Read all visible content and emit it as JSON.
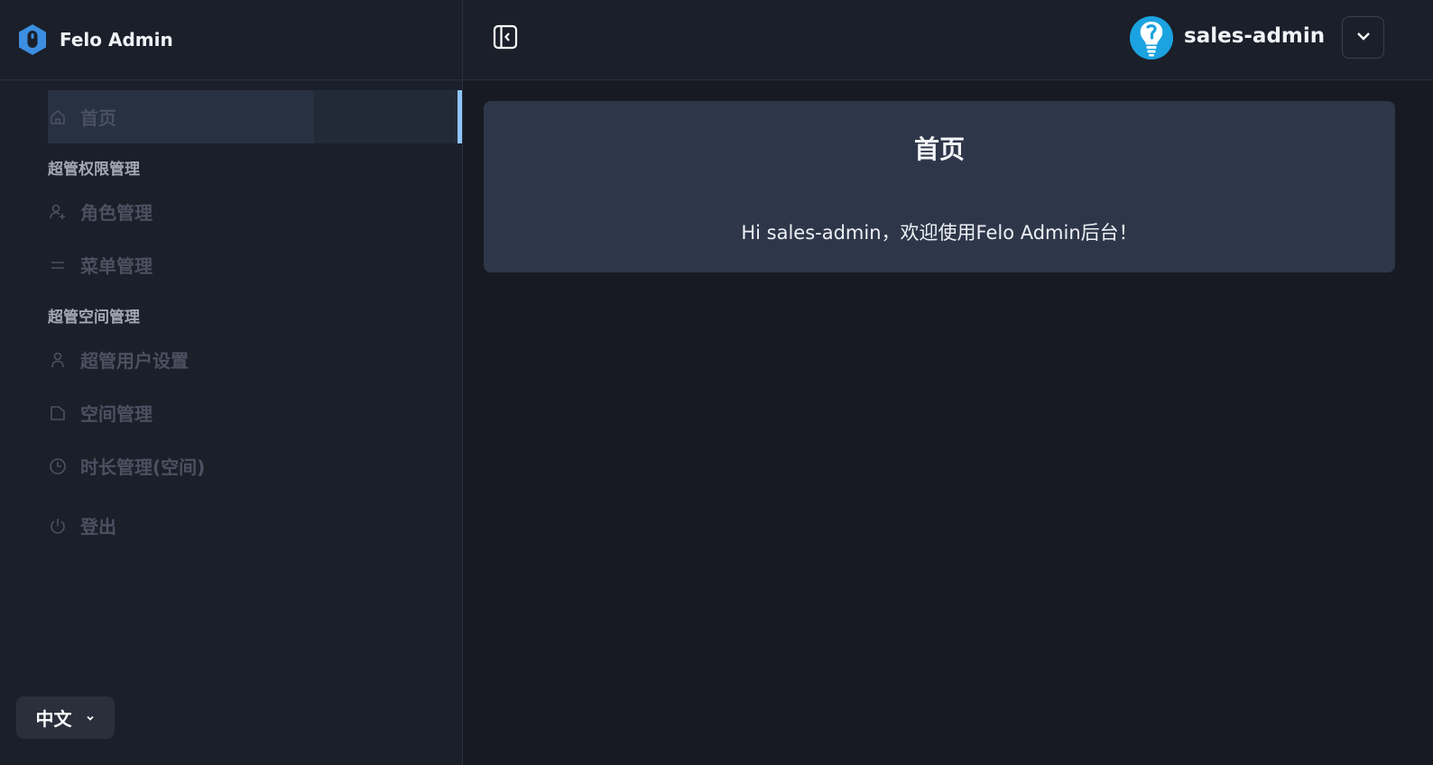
{
  "brand": {
    "name": "Felo Admin",
    "logo_icon": "felo-logo-icon",
    "logo_color": "#3b8ee0"
  },
  "sidebar": {
    "items": [
      {
        "label": "首页",
        "icon": "home-icon",
        "active": true
      },
      {
        "group": "超管权限管理"
      },
      {
        "label": "角色管理",
        "icon": "user-plus-icon"
      },
      {
        "label": "菜单管理",
        "icon": "menu-lines-icon"
      },
      {
        "group": "超管空间管理"
      },
      {
        "label": "超管用户设置",
        "icon": "user-icon"
      },
      {
        "label": "空间管理",
        "icon": "folder-icon"
      },
      {
        "label": "时长管理(空间)",
        "icon": "clock-icon"
      },
      {
        "label": "登出",
        "icon": "power-icon"
      }
    ],
    "group_power": "超管权限管理",
    "group_space": "超管空间管理",
    "home": "首页",
    "roles": "角色管理",
    "menus": "菜单管理",
    "super_users": "超管用户设置",
    "spaces": "空间管理",
    "duration": "时长管理(空间)",
    "logout": "登出",
    "active_indicator_color": "#8ec5ff"
  },
  "language": {
    "label": "中文",
    "icon": "chevron-down-icon"
  },
  "header": {
    "collapse_icon": "sidebar-collapse-icon",
    "user_name": "sales-admin",
    "avatar_icon": "lightbulb-avatar-icon",
    "avatar_color": "#1aa3e0",
    "menu_icon": "chevron-down-icon"
  },
  "main": {
    "card_title": "首页",
    "welcome": "Hi sales-admin，欢迎使用Felo Admin后台！"
  }
}
